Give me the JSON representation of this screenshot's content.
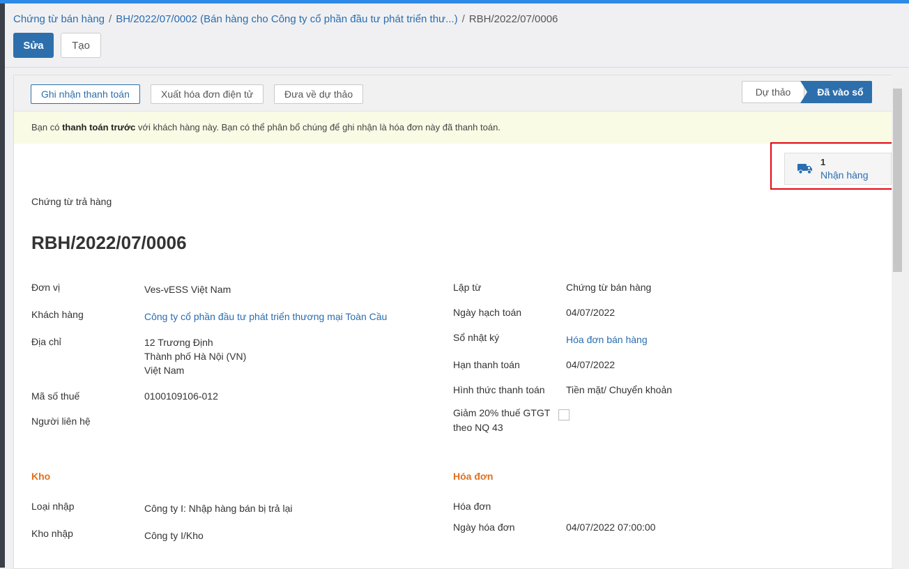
{
  "breadcrumb": {
    "root": "Chứng từ bán hàng",
    "sep1": "/",
    "parent": "BH/2022/07/0002 (Bán hàng cho Công ty cổ phần đầu tư phát triển thư...)",
    "sep2": "/",
    "current": "RBH/2022/07/0006"
  },
  "actions": {
    "edit": "Sửa",
    "create": "Tạo"
  },
  "statusbar": {
    "buttons": [
      "Ghi nhận thanh toán",
      "Xuất hóa đơn điện tử",
      "Đưa về dự thảo"
    ],
    "stages": {
      "draft": "Dự thảo",
      "posted": "Đã vào sổ"
    },
    "active_stage": "posted"
  },
  "alert": {
    "prefix": "Bạn có ",
    "bold": "thanh toán trước",
    "suffix": " với khách hàng này. Bạn có thể phân bổ chúng để ghi nhận là hóa đơn này đã thanh toán."
  },
  "smart_button": {
    "count": "1",
    "label": "Nhận hàng",
    "icon": "truck-icon"
  },
  "doc_type": "Chứng từ trả hàng",
  "doc_name": "RBH/2022/07/0006",
  "left_fields": {
    "unit": {
      "label": "Đơn vị",
      "value": "Ves-vESS Việt Nam"
    },
    "customer": {
      "label": "Khách hàng",
      "value": "Công ty cổ phần đầu tư phát triển thương mại Toàn Cầu"
    },
    "address": {
      "label": "Địa chỉ",
      "line1": "12 Trương Định",
      "line2": "Thành phố Hà Nội (VN)",
      "line3": "Việt Nam"
    },
    "tax_code": {
      "label": "Mã số thuế",
      "value": "0100109106-012"
    },
    "contact": {
      "label": "Người liên hệ",
      "value": ""
    }
  },
  "right_fields": {
    "created_from": {
      "label": "Lập từ",
      "value": "Chứng từ bán hàng"
    },
    "accounting_date": {
      "label": "Ngày hạch toán",
      "value": "04/07/2022"
    },
    "journal": {
      "label": "Sổ nhật ký",
      "value": "Hóa đơn bán hàng"
    },
    "due_date": {
      "label": "Hạn thanh toán",
      "value": "04/07/2022"
    },
    "payment_method": {
      "label": "Hình thức thanh toán",
      "value": "Tiền mặt/ Chuyển khoản"
    },
    "vat_reduction": {
      "label_line1": "Giảm 20% thuế GTGT",
      "label_line2": "theo NQ 43",
      "checked": false
    }
  },
  "warehouse": {
    "title": "Kho",
    "receipt_type": {
      "label": "Loại nhập",
      "value": "Công ty I: Nhập hàng bán bị trả lại"
    },
    "location": {
      "label": "Kho nhập",
      "value": "Công ty I/Kho"
    }
  },
  "invoice": {
    "title": "Hóa đơn",
    "invoice": {
      "label": "Hóa đơn",
      "value": ""
    },
    "invoice_date": {
      "label": "Ngày hóa đơn",
      "value": "04/07/2022 07:00:00"
    }
  },
  "colors": {
    "primary": "#2d6fad",
    "link": "#2a6db0",
    "section": "#e07020",
    "alert_bg": "#fafbe5",
    "highlight": "#e30613"
  }
}
